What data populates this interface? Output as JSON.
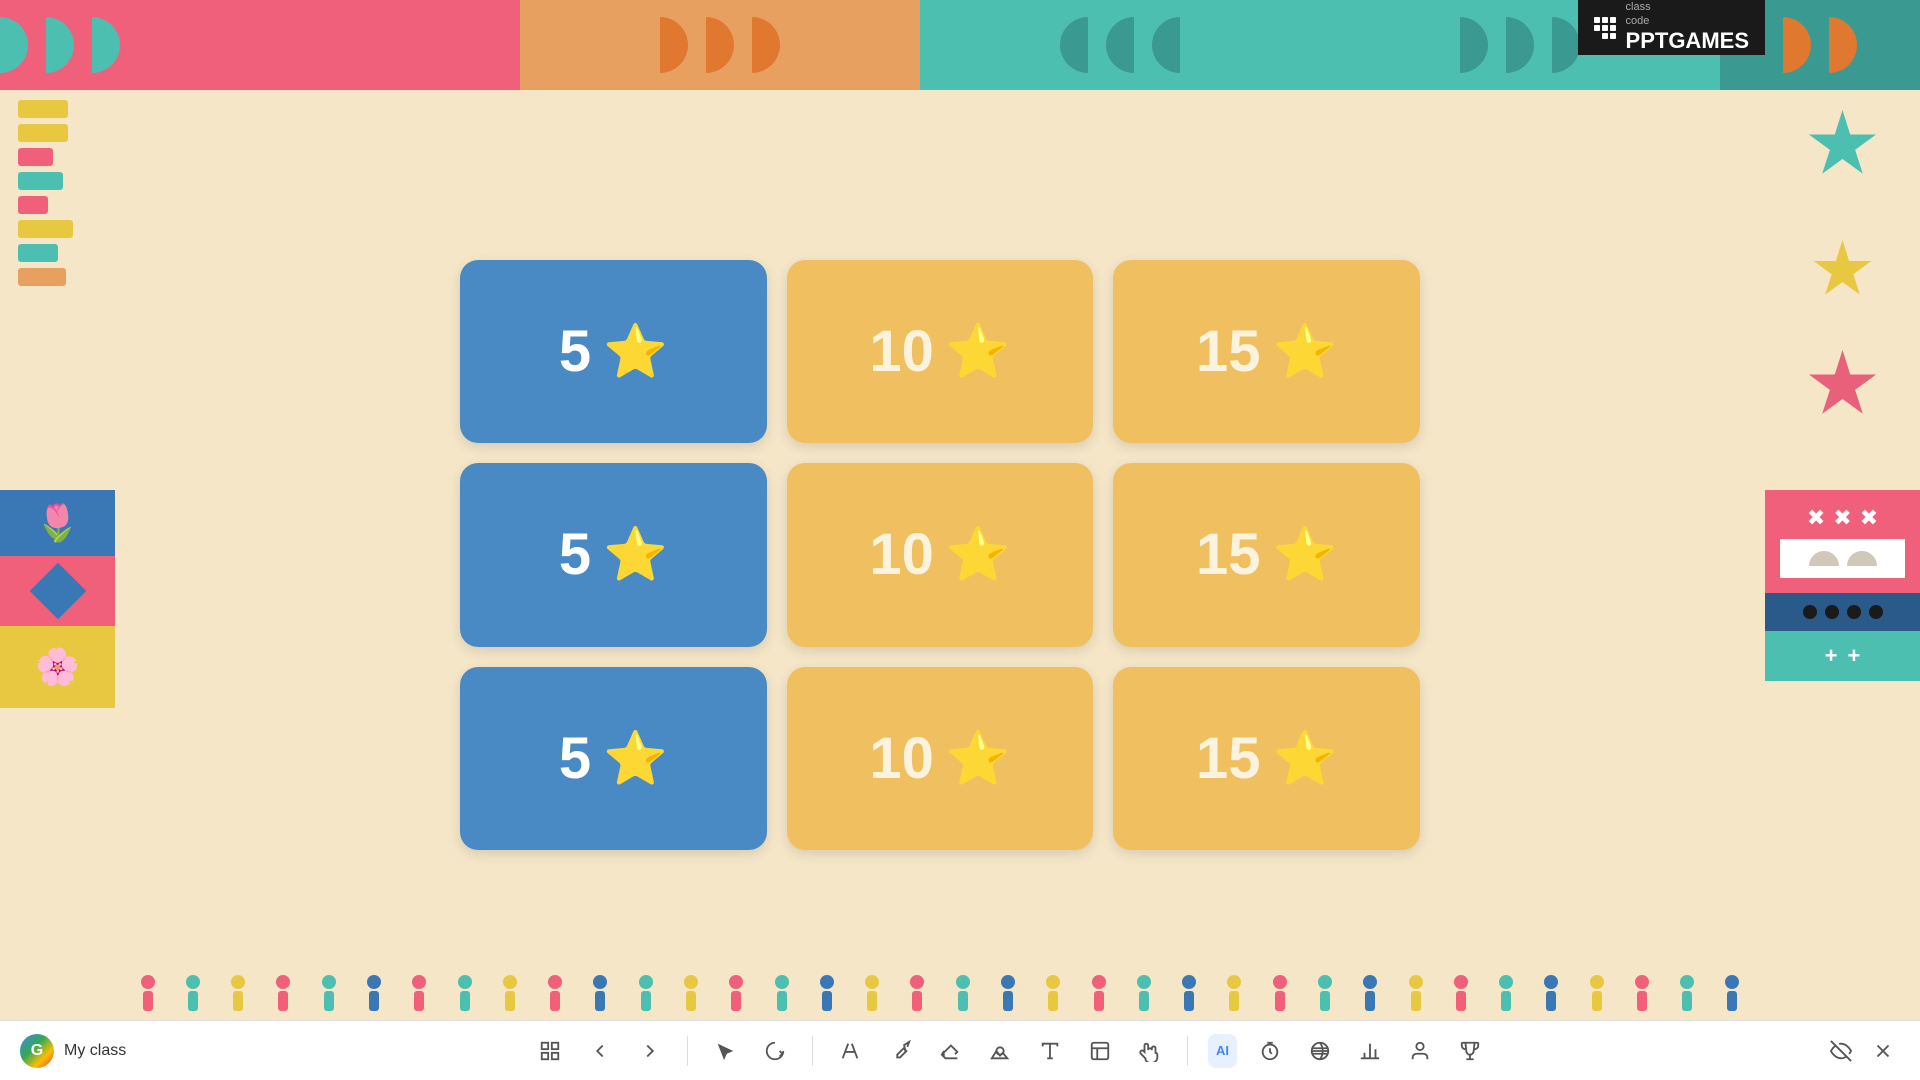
{
  "app": {
    "title": "PPTGAMES",
    "class_code_label": "class\ncode",
    "my_class": "My class"
  },
  "cards": [
    {
      "value": 5,
      "star": "⭐",
      "type": "blue",
      "row": 1,
      "col": 1
    },
    {
      "value": 10,
      "star": "⭐",
      "type": "yellow",
      "row": 1,
      "col": 2
    },
    {
      "value": 15,
      "star": "⭐",
      "type": "yellow",
      "row": 1,
      "col": 3
    },
    {
      "value": 5,
      "star": "⭐",
      "type": "blue",
      "row": 2,
      "col": 1
    },
    {
      "value": 10,
      "star": "⭐",
      "type": "yellow",
      "row": 2,
      "col": 2
    },
    {
      "value": 15,
      "star": "⭐",
      "type": "yellow",
      "row": 2,
      "col": 3
    },
    {
      "value": 5,
      "star": "⭐",
      "type": "blue",
      "row": 3,
      "col": 1
    },
    {
      "value": 10,
      "star": "⭐",
      "type": "yellow",
      "row": 3,
      "col": 2
    },
    {
      "value": 15,
      "star": "⭐",
      "type": "yellow",
      "row": 3,
      "col": 3
    }
  ],
  "colors": {
    "pink": "#f0607a",
    "teal": "#4dbfb0",
    "peach": "#e8a060",
    "yellow": "#e8c840",
    "blue_card": "#4a8ac4",
    "yellow_card": "#f0c060",
    "bg": "#f5e6c8"
  },
  "taskbar": {
    "icons": [
      "grid",
      "back",
      "forward",
      "cursor",
      "lasso",
      "text-tool",
      "pen",
      "eraser",
      "shapes",
      "text",
      "note",
      "hand",
      "ai",
      "timer",
      "globe",
      "chart",
      "person",
      "trophy"
    ],
    "right_icons": [
      "hide",
      "close"
    ]
  }
}
